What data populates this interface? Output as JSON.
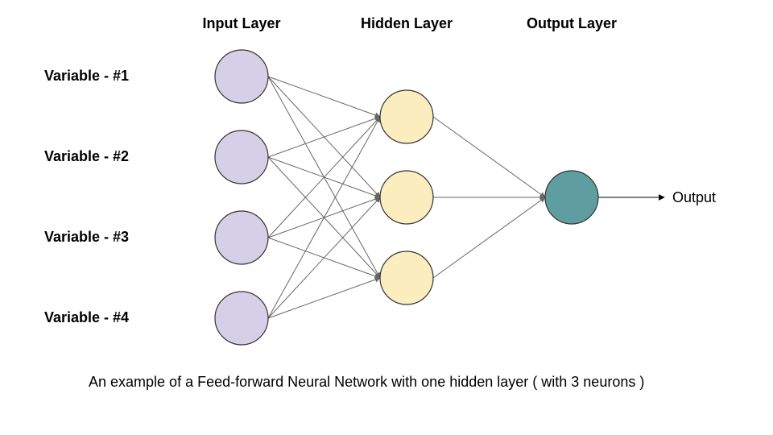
{
  "labels": {
    "inputLayer": "Input Layer",
    "hiddenLayer": "Hidden Layer",
    "outputLayer": "Output Layer",
    "output": "Output",
    "caption": "An example of a Feed-forward Neural Network with one hidden layer ( with 3 neurons )"
  },
  "variables": {
    "v1": "Variable - #1",
    "v2": "Variable - #2",
    "v3": "Variable - #3",
    "v4": "Variable - #4"
  },
  "chart_data": {
    "type": "diagram",
    "title": "An example of a Feed-forward Neural Network with one hidden layer ( with 3 neurons )",
    "layers": [
      {
        "name": "Input Layer",
        "neurons": 4,
        "color": "#d5cfe8",
        "node_labels": [
          "Variable - #1",
          "Variable - #2",
          "Variable - #3",
          "Variable - #4"
        ]
      },
      {
        "name": "Hidden Layer",
        "neurons": 3,
        "color": "#fbedbe"
      },
      {
        "name": "Output Layer",
        "neurons": 1,
        "color": "#5f9ea0",
        "output_label": "Output"
      }
    ],
    "connections": "fully_connected_feedforward"
  },
  "colors": {
    "input": "#d5cfe8",
    "hidden": "#fbedbe",
    "output": "#5f9ea0",
    "edge": "#666666"
  }
}
